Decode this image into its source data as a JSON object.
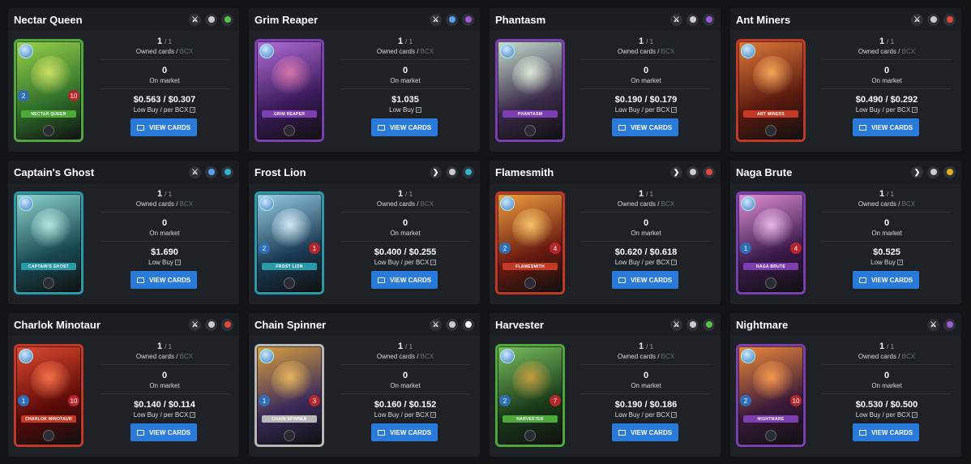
{
  "labels": {
    "owned": "Owned cards",
    "bcx": "BCX",
    "market": "On market",
    "button": "VIEW CARDS"
  },
  "cards": [
    {
      "name": "Nectar Queen",
      "owned": "1",
      "total": "/ 1",
      "market": "0",
      "price": "$0.563 / $0.307",
      "price_label": "Low Buy / per BCX",
      "art_name": "NECTAR QUEEN",
      "stat_l": "2",
      "stat_r": "10",
      "badges": [
        {
          "icon": "sword-icon",
          "glyph": "⚔",
          "color": "#ffffff"
        },
        {
          "icon": "regular-foil-icon",
          "color": "#c8ccd0"
        },
        {
          "icon": "earth-element-icon",
          "color": "#58c24a"
        }
      ],
      "colors": {
        "frame": "#4fa83a",
        "a1": "#9ad24c",
        "a2": "#2f6f2a",
        "creature": "#d8e86a"
      }
    },
    {
      "name": "Grim Reaper",
      "owned": "1",
      "total": "/ 1",
      "market": "0",
      "price": "$1.035",
      "price_label": "Low Buy",
      "art_name": "GRIM REAPER",
      "stat_l": "",
      "stat_r": "",
      "badges": [
        {
          "icon": "sword-icon",
          "glyph": "⚔",
          "color": "#ffffff"
        },
        {
          "icon": "rare-rarity-icon",
          "color": "#5aa3f0"
        },
        {
          "icon": "death-element-icon",
          "color": "#a05ad8"
        }
      ],
      "colors": {
        "frame": "#7d3fb0",
        "a1": "#b36ed8",
        "a2": "#3a1a5a",
        "creature": "#e07ab0"
      }
    },
    {
      "name": "Phantasm",
      "owned": "1",
      "total": "/ 1",
      "market": "0",
      "price": "$0.190 / $0.179",
      "price_label": "Low Buy / per BCX",
      "art_name": "PHANTASM",
      "stat_l": "",
      "stat_r": "",
      "badges": [
        {
          "icon": "sword-icon",
          "glyph": "⚔",
          "color": "#ffffff"
        },
        {
          "icon": "regular-foil-icon",
          "color": "#c8ccd0"
        },
        {
          "icon": "death-element-icon",
          "color": "#a05ad8"
        }
      ],
      "colors": {
        "frame": "#7d3fb0",
        "a1": "#c8e0d0",
        "a2": "#3a2a4a",
        "creature": "#e8f4e0"
      }
    },
    {
      "name": "Ant Miners",
      "owned": "1",
      "total": "/ 1",
      "market": "0",
      "price": "$0.490 / $0.292",
      "price_label": "Low Buy / per BCX",
      "art_name": "ANT MINERS",
      "stat_l": "",
      "stat_r": "",
      "badges": [
        {
          "icon": "sword-icon",
          "glyph": "⚔",
          "color": "#ffffff"
        },
        {
          "icon": "regular-foil-icon",
          "color": "#c8ccd0"
        },
        {
          "icon": "fire-element-icon",
          "color": "#e0483a"
        }
      ],
      "colors": {
        "frame": "#c23a24",
        "a1": "#e07a3a",
        "a2": "#5a1a10",
        "creature": "#ffb060"
      }
    },
    {
      "name": "Captain's Ghost",
      "owned": "1",
      "total": "/ 1",
      "market": "0",
      "price": "$1.690",
      "price_label": "Low Buy",
      "art_name": "CAPTAIN'S GHOST",
      "stat_l": "",
      "stat_r": "",
      "badges": [
        {
          "icon": "sword-icon",
          "glyph": "⚔",
          "color": "#ffffff"
        },
        {
          "icon": "rare-rarity-icon",
          "color": "#5aa3f0"
        },
        {
          "icon": "water-element-icon",
          "color": "#2fb6c8"
        }
      ],
      "colors": {
        "frame": "#2a9aa8",
        "a1": "#8fd6d0",
        "a2": "#1a4a52",
        "creature": "#c0f0e8"
      }
    },
    {
      "name": "Frost Lion",
      "owned": "1",
      "total": "/ 1",
      "market": "0",
      "price": "$0.400 / $0.255",
      "price_label": "Low Buy / per BCX",
      "art_name": "FROST LION",
      "stat_l": "2",
      "stat_r": "1",
      "badges": [
        {
          "icon": "chevron-right-icon",
          "glyph": "❯",
          "color": "#ffffff"
        },
        {
          "icon": "regular-foil-icon",
          "color": "#c8ccd0"
        },
        {
          "icon": "water-element-icon",
          "color": "#2fb6c8"
        }
      ],
      "colors": {
        "frame": "#2a9aa8",
        "a1": "#9ad0e8",
        "a2": "#1a3a52",
        "creature": "#e0f4ff"
      }
    },
    {
      "name": "Flamesmith",
      "owned": "1",
      "total": "/ 1",
      "market": "0",
      "price": "$0.620 / $0.618",
      "price_label": "Low Buy / per BCX",
      "art_name": "FLAMESMITH",
      "stat_l": "2",
      "stat_r": "4",
      "badges": [
        {
          "icon": "chevron-right-icon",
          "glyph": "❯",
          "color": "#ffffff"
        },
        {
          "icon": "regular-foil-icon",
          "color": "#c8ccd0"
        },
        {
          "icon": "fire-element-icon",
          "color": "#e0483a"
        }
      ],
      "colors": {
        "frame": "#c23a24",
        "a1": "#f0a040",
        "a2": "#6a1a10",
        "creature": "#ffd070"
      }
    },
    {
      "name": "Naga Brute",
      "owned": "1",
      "total": "/ 1",
      "market": "0",
      "price": "$0.525",
      "price_label": "Low Buy",
      "art_name": "NAGA BRUTE",
      "stat_l": "1",
      "stat_r": "4",
      "badges": [
        {
          "icon": "chevron-right-icon",
          "glyph": "❯",
          "color": "#ffffff"
        },
        {
          "icon": "regular-foil-icon",
          "color": "#c8ccd0"
        },
        {
          "icon": "dragon-element-icon",
          "color": "#e0b020"
        }
      ],
      "colors": {
        "frame": "#7d3fb0",
        "a1": "#e090d8",
        "a2": "#3a1a4a",
        "creature": "#f4c0f0"
      }
    },
    {
      "name": "Charlok Minotaur",
      "owned": "1",
      "total": "/ 1",
      "market": "0",
      "price": "$0.140 / $0.114",
      "price_label": "Low Buy / per BCX",
      "art_name": "CHARLOK MINOTAUR",
      "stat_l": "1",
      "stat_r": "10",
      "badges": [
        {
          "icon": "sword-icon",
          "glyph": "⚔",
          "color": "#ffffff"
        },
        {
          "icon": "regular-foil-icon",
          "color": "#c8ccd0"
        },
        {
          "icon": "fire-element-icon",
          "color": "#e0483a"
        }
      ],
      "colors": {
        "frame": "#c23a24",
        "a1": "#e04a30",
        "a2": "#5a0a08",
        "creature": "#ff7a50"
      }
    },
    {
      "name": "Chain Spinner",
      "owned": "1",
      "total": "/ 1",
      "market": "0",
      "price": "$0.160 / $0.152",
      "price_label": "Low Buy / per BCX",
      "art_name": "CHAIN SPINNER",
      "stat_l": "1",
      "stat_r": "3",
      "badges": [
        {
          "icon": "sword-icon",
          "glyph": "⚔",
          "color": "#ffffff"
        },
        {
          "icon": "regular-foil-icon",
          "color": "#c8ccd0"
        },
        {
          "icon": "life-element-icon",
          "color": "#ffffff"
        }
      ],
      "colors": {
        "frame": "#b8b8b8",
        "a1": "#d8a040",
        "a2": "#3a2a5a",
        "creature": "#f0c060"
      }
    },
    {
      "name": "Harvester",
      "owned": "1",
      "total": "/ 1",
      "market": "0",
      "price": "$0.190 / $0.186",
      "price_label": "Low Buy / per BCX",
      "art_name": "HARVESTER",
      "stat_l": "2",
      "stat_r": "7",
      "badges": [
        {
          "icon": "sword-icon",
          "glyph": "⚔",
          "color": "#ffffff"
        },
        {
          "icon": "regular-foil-icon",
          "color": "#c8ccd0"
        },
        {
          "icon": "earth-element-icon",
          "color": "#58c24a"
        }
      ],
      "colors": {
        "frame": "#4fa83a",
        "a1": "#7ac060",
        "a2": "#1a3a1a",
        "creature": "#d0a040"
      }
    },
    {
      "name": "Nightmare",
      "owned": "1",
      "total": "/ 1",
      "market": "0",
      "price": "$0.530 / $0.500",
      "price_label": "Low Buy / per BCX",
      "art_name": "NIGHTMARE",
      "stat_l": "2",
      "stat_r": "10",
      "badges": [
        {
          "icon": "sword-icon",
          "glyph": "⚔",
          "color": "#ffffff"
        },
        {
          "icon": "death-element-icon",
          "color": "#a05ad8"
        }
      ],
      "colors": {
        "frame": "#7d3fb0",
        "a1": "#f08a3a",
        "a2": "#3a1a3a",
        "creature": "#ffa050"
      }
    }
  ]
}
